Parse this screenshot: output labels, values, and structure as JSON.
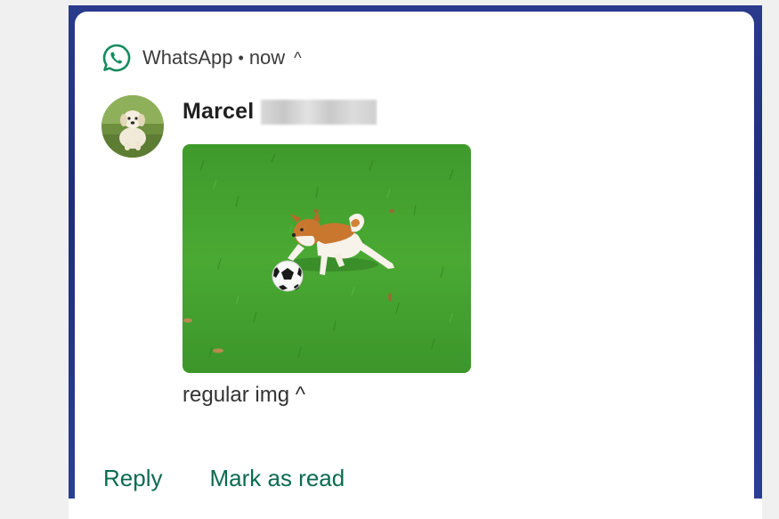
{
  "notification": {
    "app_name": "WhatsApp",
    "separator": "•",
    "time": "now",
    "expand_glyph": "^",
    "sender": "Marcel",
    "message": "regular img ^",
    "actions": {
      "reply": "Reply",
      "mark_read": "Mark as read"
    }
  },
  "icons": {
    "app": "whatsapp-icon",
    "expand": "chevron-up-icon"
  },
  "colors": {
    "accent": "#0b6b52",
    "wallpaper": "#2a3a8c",
    "whatsapp_green": "#128c5e"
  }
}
